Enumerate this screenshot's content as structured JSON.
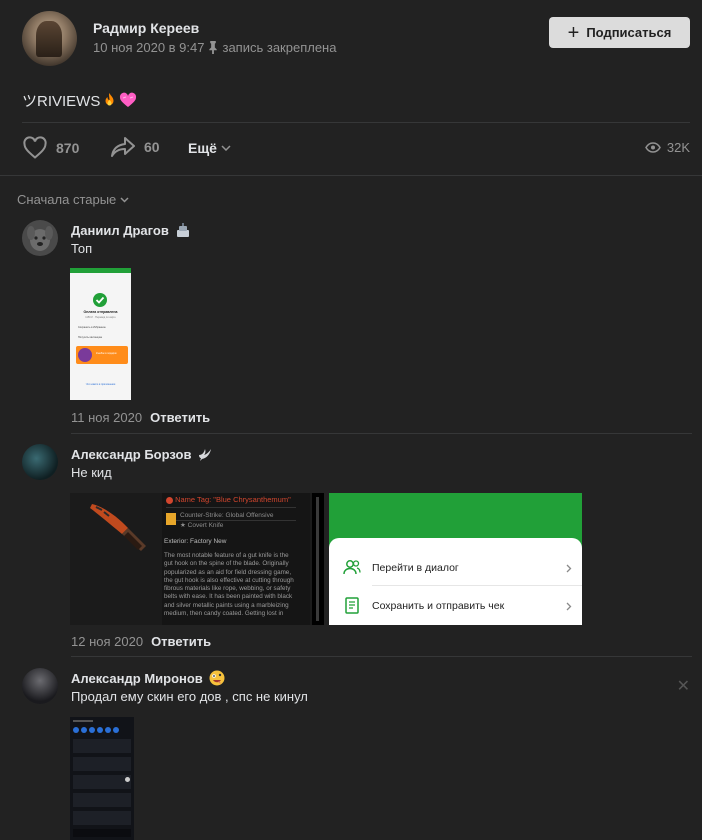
{
  "post": {
    "author": "Радмир Кереев",
    "date": "10 ноя 2020 в 9:47",
    "pinned": "запись закреплена",
    "subscribe_label": "Подписаться",
    "text": "ツRIVIEWS",
    "likes": "870",
    "shares": "60",
    "more_label": "Ещё",
    "views": "32K"
  },
  "sort_label": "Сначала старые",
  "comments": [
    {
      "name": "Даниил Драгов",
      "text": "Топ",
      "date": "11 ноя 2020",
      "reply": "Ответить",
      "attachment": {
        "title": "Оплата отправлена",
        "subtitle": "1150 ₽ · Перевод по карте",
        "row1": "Сохранить в Избранное",
        "row2": "Получить квитанцию",
        "promo": "Кэшбэк в подарок",
        "link": "Что нового в приложении"
      }
    },
    {
      "name": "Александр Борзов",
      "text": "Не кид",
      "date": "12 ноя 2020",
      "reply": "Ответить",
      "item": {
        "tag": "Name Tag: \"Blue Chrysanthemum\"",
        "game": "Counter-Strike: Global Offensive",
        "type": "★ Covert Knife",
        "exterior": "Exterior: Factory New",
        "description": "The most notable feature of a gut knife is the gut hook on the spine of the blade. Originally popularized as an aid for field dressing game, the gut hook is also effective at cutting through fibrous materials like rope, webbing, or safety belts with ease. It has been painted with black and silver metallic paints using a marbleizing medium, then candy coated. Getting lost in"
      },
      "menu": {
        "item1": "Перейти в диалог",
        "item2": "Сохранить и отправить чек"
      }
    },
    {
      "name": "Александр Миронов",
      "text": "Продал ему скин его дов , спс не кинул"
    }
  ],
  "colors": {
    "background": "#222222",
    "text": "#e1e3e6",
    "muted": "#939393",
    "green": "#21a038"
  }
}
